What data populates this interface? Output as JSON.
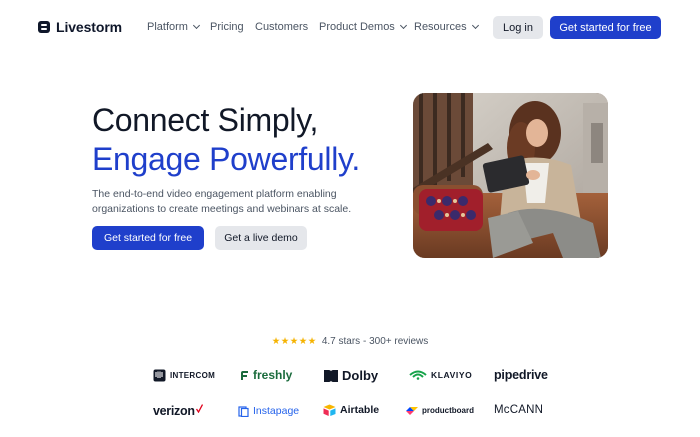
{
  "brand": {
    "name": "Livestorm"
  },
  "nav": {
    "links": [
      {
        "label": "Platform",
        "dropdown": true
      },
      {
        "label": "Pricing",
        "dropdown": false
      },
      {
        "label": "Customers",
        "dropdown": false
      },
      {
        "label": "Product Demos",
        "dropdown": true
      },
      {
        "label": "Resources",
        "dropdown": true
      }
    ],
    "login_label": "Log in",
    "cta_label": "Get started for free"
  },
  "hero": {
    "title_line1": "Connect Simply,",
    "title_line2": "Engage Powerfully.",
    "subtitle": "The end-to-end video engagement platform enabling organizations to create meetings and webinars at scale.",
    "primary_cta": "Get started for free",
    "secondary_cta": "Get a live demo",
    "image_icon": "woman-with-tablet-photo"
  },
  "rating": {
    "stars": "★★★★★",
    "text": "4.7 stars - 300+ reviews"
  },
  "customer_logos": [
    {
      "name": "INTERCOM"
    },
    {
      "name": "freshly"
    },
    {
      "name": "Dolby"
    },
    {
      "name": "KLAVIYO"
    },
    {
      "name": "pipedrive"
    },
    {
      "name": "verizon"
    },
    {
      "name": "Instapage"
    },
    {
      "name": "Airtable"
    },
    {
      "name": "productboard"
    },
    {
      "name": "McCANN"
    }
  ],
  "colors": {
    "accent": "#1f3fcb",
    "text": "#111827",
    "muted": "#4b5563",
    "button_secondary": "#e5e7eb",
    "star": "#f5b301"
  }
}
